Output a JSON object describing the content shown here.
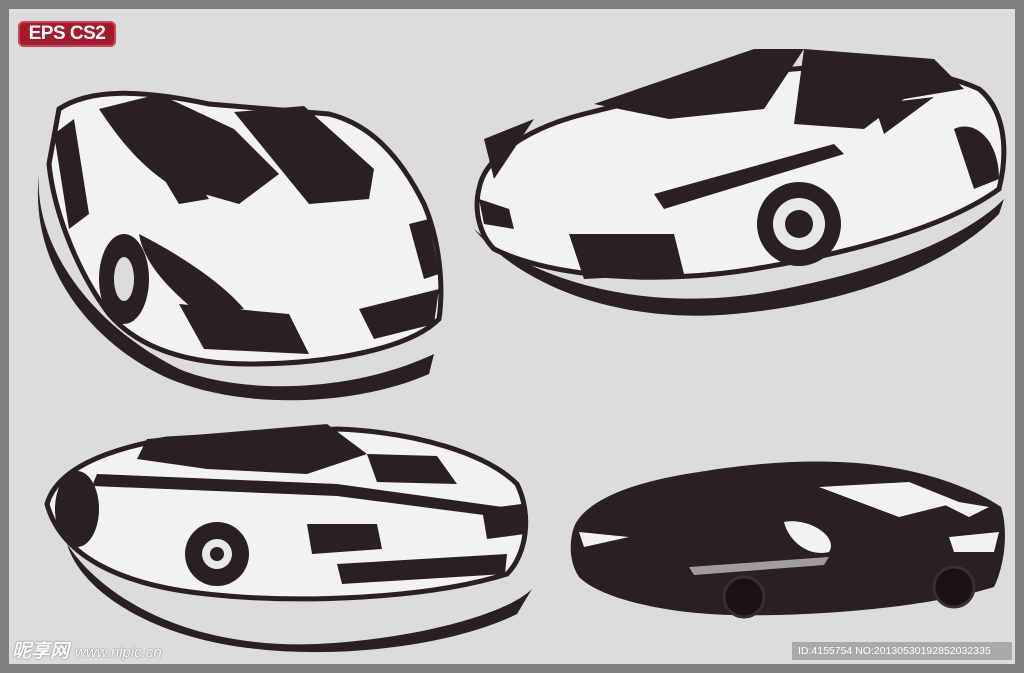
{
  "badge": {
    "label": "EPS CS2"
  },
  "header_blurb": {
    "text": ""
  },
  "watermark": {
    "brand": "昵享网",
    "url": "www.nipic.cn"
  },
  "id_bar": {
    "text": "ID:4155754 NO:20130530192852032335"
  },
  "colors": {
    "background": "#dcdcdc",
    "ink": "#2a1f22",
    "badge": "#a31a2b",
    "frame": "#808080"
  },
  "illustrations": [
    {
      "name": "sports-car-front-left"
    },
    {
      "name": "sports-car-front-right"
    },
    {
      "name": "sports-car-rear"
    },
    {
      "name": "sports-car-silhouette-side"
    }
  ]
}
